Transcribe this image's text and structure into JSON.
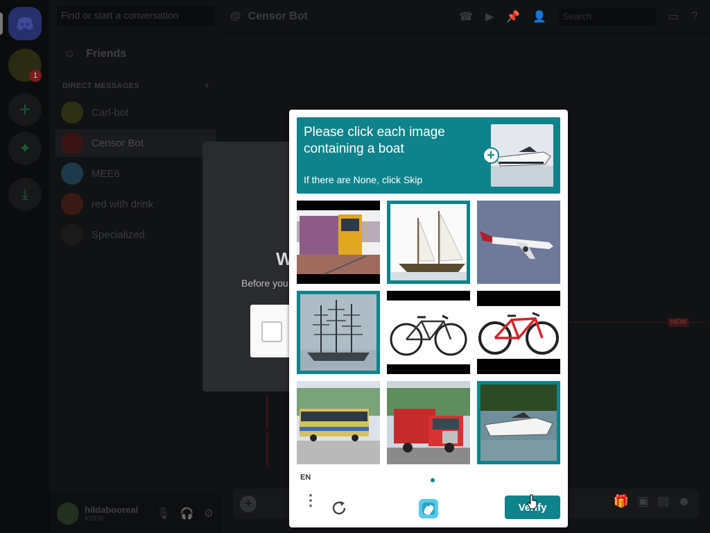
{
  "discord": {
    "rail": {
      "notification_count": "1"
    },
    "sidebar": {
      "search_placeholder": "Find or start a conversation",
      "friends_label": "Friends",
      "direct_messages_header": "DIRECT MESSAGES",
      "dm_items": [
        {
          "name": "Carl-bot",
          "avatar_color": "#2d3014",
          "active": false
        },
        {
          "name": "Censor Bot",
          "avatar_color": "#3a1414",
          "active": true
        },
        {
          "name": "MEE6",
          "avatar_color": "#1d3a4a",
          "active": false
        },
        {
          "name": "red with drink",
          "avatar_color": "#3a1a14",
          "active": false
        },
        {
          "name": "Specialized",
          "avatar_color": "#1a1a1a",
          "active": false
        }
      ]
    },
    "user": {
      "name": "hildabooreal",
      "status": "#2836"
    },
    "header": {
      "channel_name": "Censor Bot",
      "search_placeholder": "Search"
    },
    "new_badge": "NEW",
    "verification": {
      "title": "W",
      "text": "Before you"
    }
  },
  "captcha": {
    "prompt": "Please click each image containing a boat",
    "subtext": "If there are None, click Skip",
    "language": "EN",
    "verify_label": "Verify",
    "accent_color": "#0f838b",
    "tiles": [
      {
        "subject": "train",
        "selected": false
      },
      {
        "subject": "sailboat",
        "selected": true
      },
      {
        "subject": "airplane",
        "selected": false
      },
      {
        "subject": "tall ship",
        "selected": true
      },
      {
        "subject": "road bicycle",
        "selected": false
      },
      {
        "subject": "mountain bicycle",
        "selected": false
      },
      {
        "subject": "bus",
        "selected": false
      },
      {
        "subject": "fire truck",
        "selected": false
      },
      {
        "subject": "speedboat",
        "selected": true
      }
    ]
  }
}
